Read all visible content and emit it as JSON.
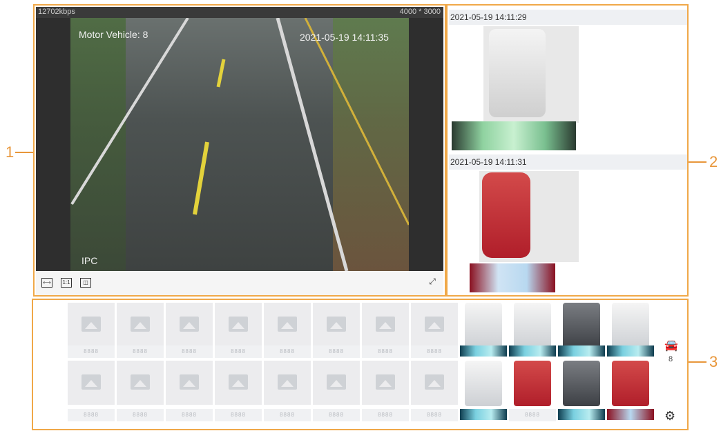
{
  "callouts": [
    "1",
    "2",
    "3"
  ],
  "live_view": {
    "bitrate": "12702kbps",
    "resolution": "4000 * 3000",
    "vehicle_count": "Motor Vehicle: 8",
    "timestamp": "2021-05-19 14:11:35",
    "camera_label": "IPC"
  },
  "snapshots": [
    {
      "time": "2021-05-19 14:11:29",
      "vehicle": "white van"
    },
    {
      "time": "2021-05-19 14:11:31",
      "vehicle": "red car"
    }
  ],
  "gallery": {
    "placeholder_plate": "8888",
    "placeholder_tiles_per_row": 8,
    "vehicles_row1": [
      "white taxi",
      "white car",
      "dark grey car",
      "white van"
    ],
    "vehicles_row2": [
      "white car",
      "red truck",
      "grey car",
      "red car"
    ],
    "plate_row2_second": "8888",
    "vehicle_count": "8"
  },
  "colors": {
    "callout": "#e8963a",
    "panel_border": "#f0a848"
  }
}
